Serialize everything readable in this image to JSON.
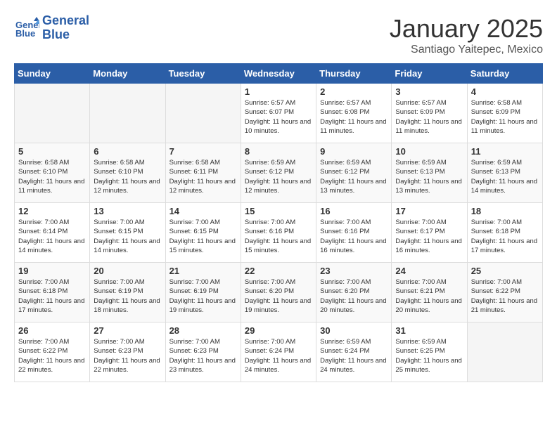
{
  "header": {
    "logo_line1": "General",
    "logo_line2": "Blue",
    "month": "January 2025",
    "location": "Santiago Yaitepec, Mexico"
  },
  "days_of_week": [
    "Sunday",
    "Monday",
    "Tuesday",
    "Wednesday",
    "Thursday",
    "Friday",
    "Saturday"
  ],
  "weeks": [
    [
      {
        "num": "",
        "info": ""
      },
      {
        "num": "",
        "info": ""
      },
      {
        "num": "",
        "info": ""
      },
      {
        "num": "1",
        "info": "Sunrise: 6:57 AM\nSunset: 6:07 PM\nDaylight: 11 hours and 10 minutes."
      },
      {
        "num": "2",
        "info": "Sunrise: 6:57 AM\nSunset: 6:08 PM\nDaylight: 11 hours and 11 minutes."
      },
      {
        "num": "3",
        "info": "Sunrise: 6:57 AM\nSunset: 6:09 PM\nDaylight: 11 hours and 11 minutes."
      },
      {
        "num": "4",
        "info": "Sunrise: 6:58 AM\nSunset: 6:09 PM\nDaylight: 11 hours and 11 minutes."
      }
    ],
    [
      {
        "num": "5",
        "info": "Sunrise: 6:58 AM\nSunset: 6:10 PM\nDaylight: 11 hours and 11 minutes."
      },
      {
        "num": "6",
        "info": "Sunrise: 6:58 AM\nSunset: 6:10 PM\nDaylight: 11 hours and 12 minutes."
      },
      {
        "num": "7",
        "info": "Sunrise: 6:58 AM\nSunset: 6:11 PM\nDaylight: 11 hours and 12 minutes."
      },
      {
        "num": "8",
        "info": "Sunrise: 6:59 AM\nSunset: 6:12 PM\nDaylight: 11 hours and 12 minutes."
      },
      {
        "num": "9",
        "info": "Sunrise: 6:59 AM\nSunset: 6:12 PM\nDaylight: 11 hours and 13 minutes."
      },
      {
        "num": "10",
        "info": "Sunrise: 6:59 AM\nSunset: 6:13 PM\nDaylight: 11 hours and 13 minutes."
      },
      {
        "num": "11",
        "info": "Sunrise: 6:59 AM\nSunset: 6:13 PM\nDaylight: 11 hours and 14 minutes."
      }
    ],
    [
      {
        "num": "12",
        "info": "Sunrise: 7:00 AM\nSunset: 6:14 PM\nDaylight: 11 hours and 14 minutes."
      },
      {
        "num": "13",
        "info": "Sunrise: 7:00 AM\nSunset: 6:15 PM\nDaylight: 11 hours and 14 minutes."
      },
      {
        "num": "14",
        "info": "Sunrise: 7:00 AM\nSunset: 6:15 PM\nDaylight: 11 hours and 15 minutes."
      },
      {
        "num": "15",
        "info": "Sunrise: 7:00 AM\nSunset: 6:16 PM\nDaylight: 11 hours and 15 minutes."
      },
      {
        "num": "16",
        "info": "Sunrise: 7:00 AM\nSunset: 6:16 PM\nDaylight: 11 hours and 16 minutes."
      },
      {
        "num": "17",
        "info": "Sunrise: 7:00 AM\nSunset: 6:17 PM\nDaylight: 11 hours and 16 minutes."
      },
      {
        "num": "18",
        "info": "Sunrise: 7:00 AM\nSunset: 6:18 PM\nDaylight: 11 hours and 17 minutes."
      }
    ],
    [
      {
        "num": "19",
        "info": "Sunrise: 7:00 AM\nSunset: 6:18 PM\nDaylight: 11 hours and 17 minutes."
      },
      {
        "num": "20",
        "info": "Sunrise: 7:00 AM\nSunset: 6:19 PM\nDaylight: 11 hours and 18 minutes."
      },
      {
        "num": "21",
        "info": "Sunrise: 7:00 AM\nSunset: 6:19 PM\nDaylight: 11 hours and 19 minutes."
      },
      {
        "num": "22",
        "info": "Sunrise: 7:00 AM\nSunset: 6:20 PM\nDaylight: 11 hours and 19 minutes."
      },
      {
        "num": "23",
        "info": "Sunrise: 7:00 AM\nSunset: 6:20 PM\nDaylight: 11 hours and 20 minutes."
      },
      {
        "num": "24",
        "info": "Sunrise: 7:00 AM\nSunset: 6:21 PM\nDaylight: 11 hours and 20 minutes."
      },
      {
        "num": "25",
        "info": "Sunrise: 7:00 AM\nSunset: 6:22 PM\nDaylight: 11 hours and 21 minutes."
      }
    ],
    [
      {
        "num": "26",
        "info": "Sunrise: 7:00 AM\nSunset: 6:22 PM\nDaylight: 11 hours and 22 minutes."
      },
      {
        "num": "27",
        "info": "Sunrise: 7:00 AM\nSunset: 6:23 PM\nDaylight: 11 hours and 22 minutes."
      },
      {
        "num": "28",
        "info": "Sunrise: 7:00 AM\nSunset: 6:23 PM\nDaylight: 11 hours and 23 minutes."
      },
      {
        "num": "29",
        "info": "Sunrise: 7:00 AM\nSunset: 6:24 PM\nDaylight: 11 hours and 24 minutes."
      },
      {
        "num": "30",
        "info": "Sunrise: 6:59 AM\nSunset: 6:24 PM\nDaylight: 11 hours and 24 minutes."
      },
      {
        "num": "31",
        "info": "Sunrise: 6:59 AM\nSunset: 6:25 PM\nDaylight: 11 hours and 25 minutes."
      },
      {
        "num": "",
        "info": ""
      }
    ]
  ]
}
